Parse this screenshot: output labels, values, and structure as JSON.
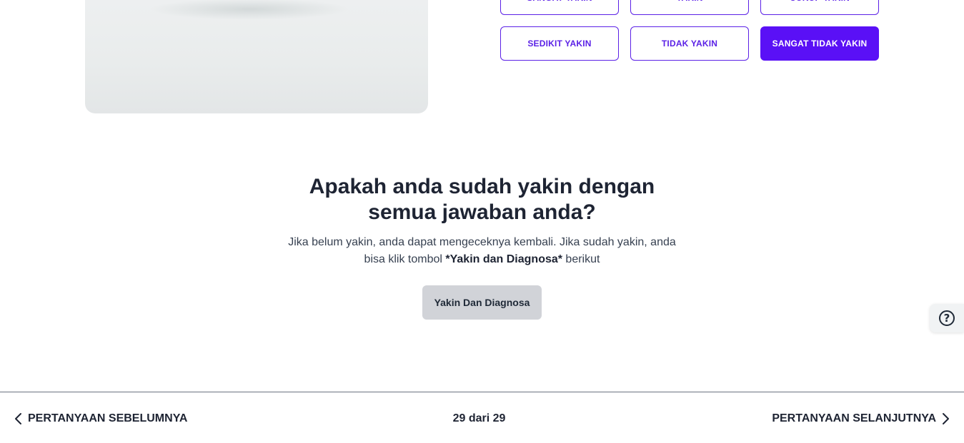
{
  "answers": {
    "row1": [
      "SANGAT YAKIN",
      "YAKIN",
      "CUKUP YAKIN"
    ],
    "row2": [
      "SEDIKIT YAKIN",
      "TIDAK YAKIN",
      "SANGAT TIDAK YAKIN"
    ],
    "selected": "SANGAT TIDAK YAKIN",
    "accent_color": "#5a10f6"
  },
  "confirm": {
    "title": "Apakah anda sudah yakin dengan semua jawaban anda?",
    "desc_prefix": "Jika belum yakin, anda dapat mengeceknya kembali. Jika sudah yakin, anda bisa klik tombol ",
    "desc_bold": "*Yakin dan Diagnosa*",
    "desc_suffix": " berikut",
    "button_label": "Yakin Dan Diagnosa"
  },
  "help": {
    "icon": "help-circle-icon",
    "glyph": "?"
  },
  "footer": {
    "prev_label": "PERTANYAAN SEBELUMNYA",
    "page_indicator": "29 dari 29",
    "next_label": "PERTANYAAN SELANJUTNYA"
  }
}
